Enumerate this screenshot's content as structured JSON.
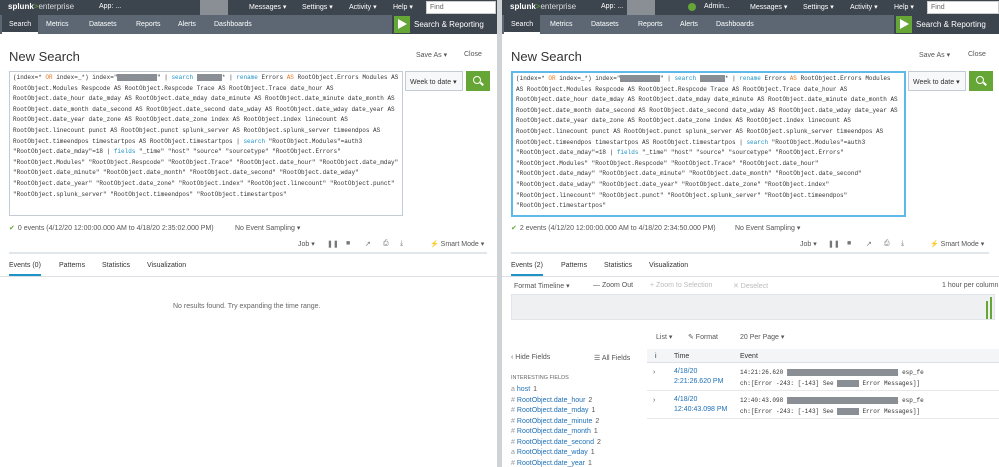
{
  "left": {
    "topbar": {
      "app": "App: ...",
      "messages": "Messages ▾",
      "settings": "Settings ▾",
      "activity": "Activity ▾",
      "help": "Help ▾",
      "find": "Find"
    },
    "nav": {
      "search": "Search",
      "metrics": "Metrics",
      "datasets": "Datasets",
      "reports": "Reports",
      "alerts": "Alerts",
      "dashboards": "Dashboards",
      "app_title": "Search & Reporting"
    },
    "title": "New Search",
    "save_as": "Save As ▾",
    "close": "Close",
    "time_picker": "Week to date ▾",
    "status": "0 events (4/12/20 12:00:00.000 AM to 4/18/20 2:35:02.000 PM)",
    "sampling": "No Event Sampling ▾",
    "job": "Job ▾",
    "mode": "⚡ Smart Mode ▾",
    "tabs": {
      "events": "Events (0)",
      "patterns": "Patterns",
      "statistics": "Statistics",
      "visualization": "Visualization"
    },
    "no_results": "No results found. Try expanding the time range."
  },
  "right": {
    "topbar": {
      "app": "App: ...",
      "admin": "Admin...",
      "messages": "Messages ▾",
      "settings": "Settings ▾",
      "activity": "Activity ▾",
      "help": "Help ▾",
      "find": "Find"
    },
    "nav": {
      "search": "Search",
      "metrics": "Metrics",
      "datasets": "Datasets",
      "reports": "Reports",
      "alerts": "Alerts",
      "dashboards": "Dashboards",
      "app_title": "Search & Reporting"
    },
    "title": "New Search",
    "save_as": "Save As ▾",
    "close": "Close",
    "time_picker": "Week to date ▾",
    "status": "2 events (4/12/20 12:00:00.000 AM to 4/18/20 2:34:50.000 PM)",
    "sampling": "No Event Sampling ▾",
    "job": "Job ▾",
    "mode": "⚡ Smart Mode ▾",
    "tabs": {
      "events": "Events (2)",
      "patterns": "Patterns",
      "statistics": "Statistics",
      "visualization": "Visualization"
    },
    "timeline": {
      "format": "Format Timeline ▾",
      "zoom_out": "— Zoom Out",
      "zoom_sel": "+ Zoom to Selection",
      "deselect": "✕ Deselect",
      "scale": "1 hour per column"
    },
    "list": {
      "list": "List ▾",
      "format": "✎ Format",
      "per_page": "20 Per Page ▾"
    },
    "fields": {
      "hide": "‹ Hide Fields",
      "all": "☰ All Fields",
      "heading": "INTERESTING FIELDS",
      "items": [
        {
          "type": "a",
          "name": "host",
          "count": "1"
        },
        {
          "type": "#",
          "name": "RootObject.date_hour",
          "count": "2"
        },
        {
          "type": "#",
          "name": "RootObject.date_mday",
          "count": "1"
        },
        {
          "type": "#",
          "name": "RootObject.date_minute",
          "count": "2"
        },
        {
          "type": "#",
          "name": "RootObject.date_month",
          "count": "1"
        },
        {
          "type": "#",
          "name": "RootObject.date_second",
          "count": "2"
        },
        {
          "type": "a",
          "name": "RootObject.date_wday",
          "count": "1"
        },
        {
          "type": "#",
          "name": "RootObject.date_year",
          "count": "1"
        }
      ]
    },
    "table": {
      "i": "i",
      "time": "Time",
      "event": "Event"
    },
    "events": [
      {
        "time1": "4/18/20",
        "time2": "2:21:26.620 PM",
        "line1": "14:21:26.620",
        "tail": "esp_fe",
        "line2a": "ch:[Error -243: [-143] See",
        "line2b": "Error Messages]]"
      },
      {
        "time1": "4/18/20",
        "time2": "12:40:43.098 PM",
        "line1": "12:40:43.098",
        "tail": "esp_fe",
        "line2a": "ch:[Error -243: [-143] See",
        "line2b": "Error Messages]]"
      }
    ]
  },
  "query": {
    "p1": "(index=* ",
    "or": "OR",
    "p2": " index=_*) index=\"",
    "r1": "XXXXXXXXXXX",
    "p3": "\" | ",
    "search": "search",
    "r2": "XXXXXXX",
    "p4": "* | ",
    "rename": "rename",
    "body1": " Errors ",
    "as": "AS",
    "rest": " RootObject.Errors Modules AS RootObject.Modules Respcode AS RootObject.Respcode Trace AS RootObject.Trace date_hour AS RootObject.date_hour date_mday AS RootObject.date_mday date_minute AS RootObject.date_minute date_month AS RootObject.date_month date_second AS RootObject.date_second date_wday AS RootObject.date_wday date_year AS RootObject.date_year date_zone AS RootObject.date_zone index AS RootObject.index linecount AS RootObject.linecount punct AS RootObject.punct splunk_server AS RootObject.splunk_server timeendpos AS RootObject.timeendpos timestartpos AS RootObject.timestartpos | ",
    "search2": "search",
    "filter": " \"RootObject.Modules\"=auth3 \"RootObject.date_mday\"=18 | ",
    "fields": "fields",
    "tail": " \"_time\" \"host\" \"source\" \"sourcetype\" \"RootObject.Errors\" \"RootObject.Modules\" \"RootObject.Respcode\" \"RootObject.Trace\" \"RootObject.date_hour\" \"RootObject.date_mday\" \"RootObject.date_minute\" \"RootObject.date_month\" \"RootObject.date_second\" \"RootObject.date_wday\" \"RootObject.date_year\" \"RootObject.date_zone\" \"RootObject.index\" \"RootObject.linecount\" \"RootObject.punct\" \"RootObject.splunk_server\" \"RootObject.timeendpos\" \"RootObject.timestartpos\""
  },
  "brand": {
    "name": "splunk",
    "gt": ">",
    "suffix": "enterprise"
  },
  "colors": {
    "accent_green": "#65a637",
    "nav_dark": "#3c444d",
    "nav_mid": "#5c6773",
    "link_blue": "#1e6fb6"
  }
}
